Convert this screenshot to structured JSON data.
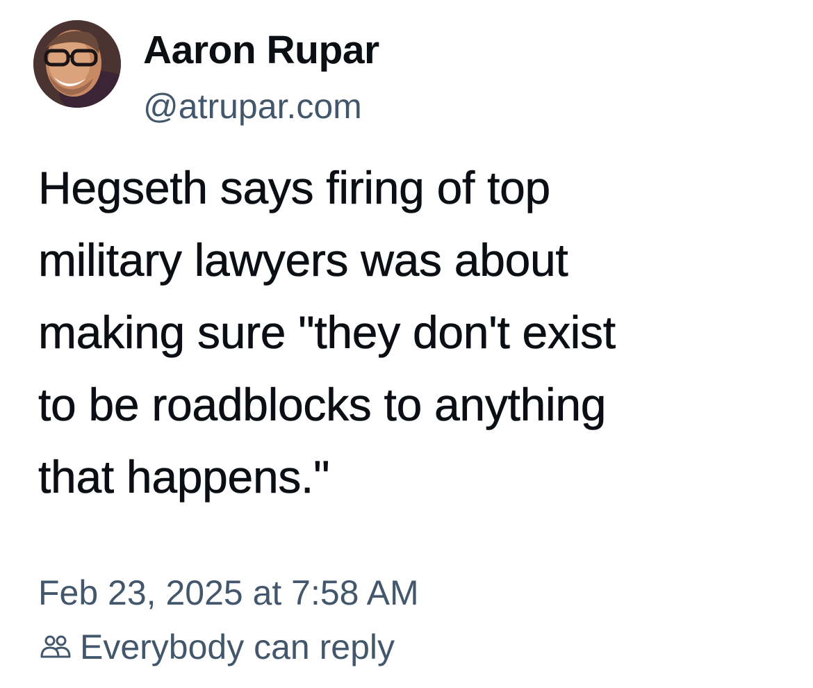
{
  "post": {
    "author": {
      "name": "Aaron Rupar",
      "handle": "@atrupar.com",
      "avatar_icon": "profile-photo"
    },
    "text_lines": [
      "Hegseth says firing of top",
      "military lawyers was about",
      "making sure \"they don't exist",
      "to be roadblocks to anything",
      "that happens.\""
    ],
    "timestamp": "Feb 23, 2025 at 7:58 AM",
    "reply_setting": {
      "icon": "people-icon",
      "label": "Everybody can reply"
    }
  },
  "colors": {
    "primary_text": "#0b0f14",
    "secondary_text": "#42576c",
    "background": "#ffffff"
  }
}
